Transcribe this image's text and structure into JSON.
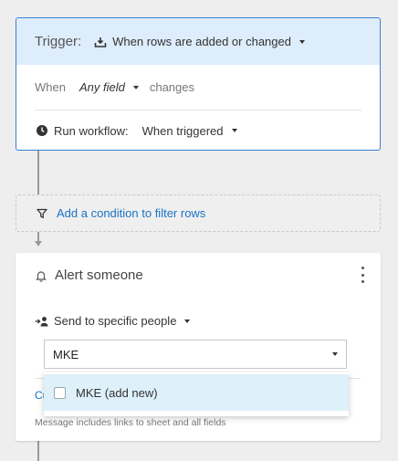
{
  "trigger": {
    "label": "Trigger:",
    "value": "When rows are added or changed",
    "when_label": "When",
    "field_value": "Any field",
    "changes_label": "changes",
    "run_label": "Run workflow:",
    "run_value": "When triggered"
  },
  "condition": {
    "link_label": "Add a condition to filter rows"
  },
  "alert": {
    "title": "Alert someone",
    "send_label": "Send to specific people",
    "input_value": "MKE",
    "customize_link": "Cu",
    "message_note": "Message includes links to sheet and all fields"
  },
  "dropdown": {
    "options": [
      {
        "label": "MKE (add new)",
        "checked": false
      }
    ]
  },
  "colors": {
    "accent": "#3a7fd6",
    "link": "#1a73c8",
    "trigger_header_bg": "#deedfb",
    "highlight": "#def0fa"
  }
}
